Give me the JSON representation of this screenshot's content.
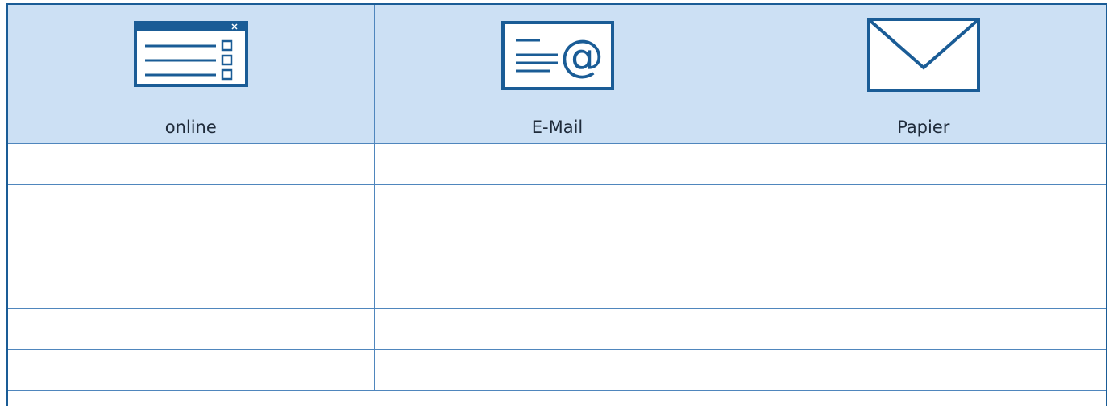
{
  "columns": [
    {
      "label": "online",
      "icon": "online-form-icon"
    },
    {
      "label": "E-Mail",
      "icon": "email-at-icon"
    },
    {
      "label": "Papier",
      "icon": "envelope-icon"
    }
  ],
  "rows": [
    [
      "",
      "",
      ""
    ],
    [
      "",
      "",
      ""
    ],
    [
      "",
      "",
      ""
    ],
    [
      "",
      "",
      ""
    ],
    [
      "",
      "",
      ""
    ],
    [
      "",
      "",
      ""
    ]
  ],
  "colors": {
    "header_background": "#cce0f4",
    "border": "#1a5c96",
    "grid_line": "#4f86bd",
    "icon": "#1a5c96"
  }
}
